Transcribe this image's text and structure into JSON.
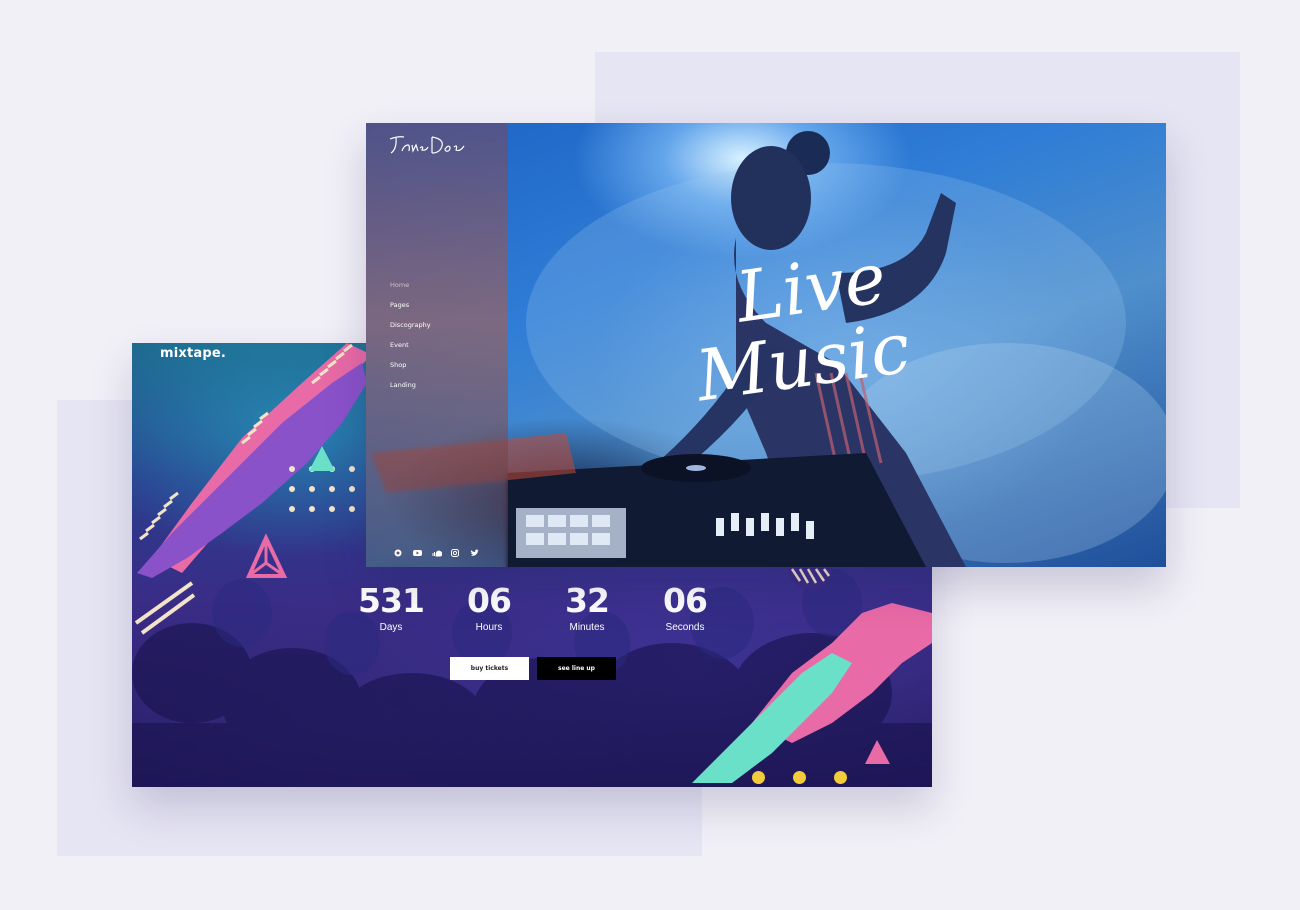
{
  "mixtape": {
    "logo": "mixtape.",
    "countdown": [
      {
        "value": "531",
        "label": "Days"
      },
      {
        "value": "06",
        "label": "Hours"
      },
      {
        "value": "32",
        "label": "Minutes"
      },
      {
        "value": "06",
        "label": "Seconds"
      }
    ],
    "buy_label": "buy tickets",
    "lineup_label": "see line up"
  },
  "janedoe": {
    "logo": "Jane Doe",
    "nav": [
      "Home",
      "Pages",
      "Discography",
      "Event",
      "Shop",
      "Landing"
    ],
    "active_nav": "Home",
    "social_icons": [
      "target-icon",
      "youtube-icon",
      "soundcloud-icon",
      "instagram-icon",
      "twitter-icon"
    ],
    "hero_line1": "Live",
    "hero_line2": "Music"
  },
  "colors": {
    "page_bg": "#f1f0f7",
    "block_bg": "#e6e5f3",
    "pink": "#e86aa6",
    "purple": "#8a52c9",
    "mint": "#6be0c8",
    "yellow": "#f2cc3a"
  }
}
